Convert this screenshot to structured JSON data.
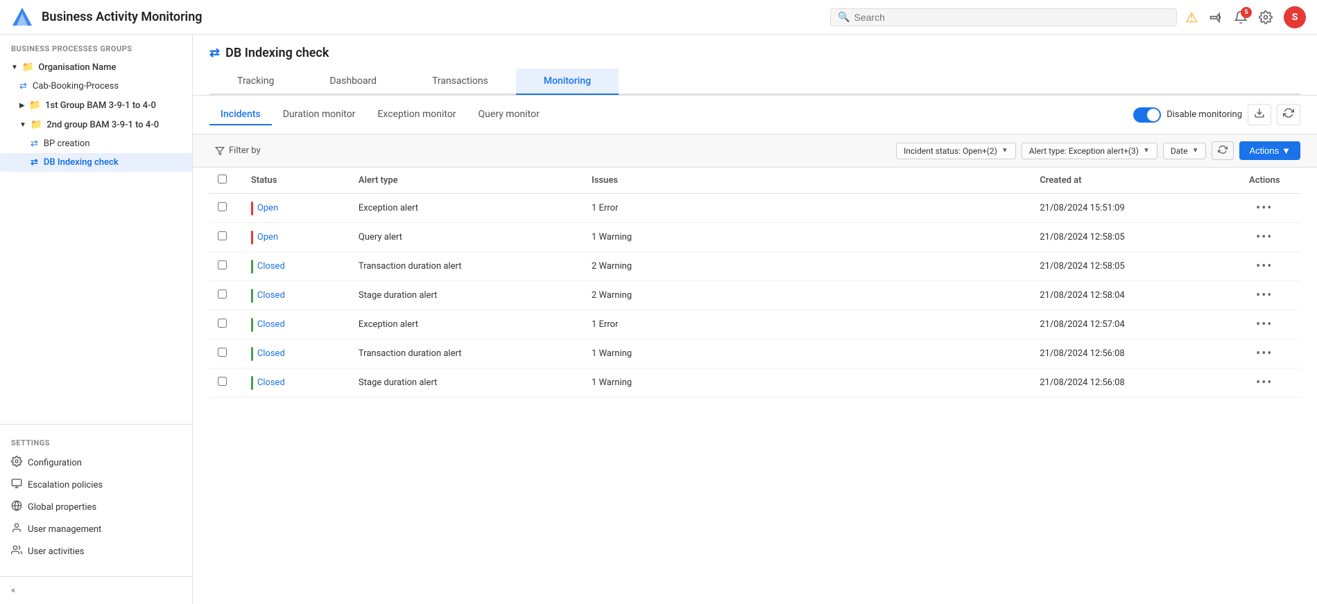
{
  "app": {
    "title": "Business Activity Monitoring",
    "logo_alt": "logo"
  },
  "search": {
    "placeholder": "Search"
  },
  "nav_icons": {
    "warning": "⚠",
    "bell": "🔔",
    "notification_count": "5",
    "megaphone": "📣",
    "gear": "⚙",
    "avatar_letter": "S"
  },
  "sidebar": {
    "groups_title": "BUSINESS PROCESSES GROUPS",
    "org_name": "Organisation Name",
    "groups": [
      {
        "name": "1st Group BAM 3-9-1 to 4-0",
        "expanded": false
      },
      {
        "name": "2nd group BAM 3-9-1 to 4-0",
        "expanded": true,
        "children": [
          {
            "name": "BP creation",
            "type": "bp"
          },
          {
            "name": "DB Indexing check",
            "type": "bp",
            "active": true
          }
        ]
      }
    ],
    "cab_booking": "Cab-Booking-Process",
    "settings_title": "SETTINGS",
    "settings_items": [
      {
        "icon": "⚙",
        "label": "Configuration"
      },
      {
        "icon": "📋",
        "label": "Escalation policies"
      },
      {
        "icon": "🌐",
        "label": "Global properties"
      },
      {
        "icon": "👤",
        "label": "User management"
      },
      {
        "icon": "👥",
        "label": "User activities"
      }
    ],
    "collapse_tooltip": "Collapse"
  },
  "page": {
    "title": "DB Indexing check",
    "title_icon": "⇄"
  },
  "tabs_top": [
    {
      "label": "Tracking",
      "active": false
    },
    {
      "label": "Dashboard",
      "active": false
    },
    {
      "label": "Transactions",
      "active": false
    },
    {
      "label": "Monitoring",
      "active": true
    }
  ],
  "sub_tabs": [
    {
      "label": "Incidents",
      "active": true
    },
    {
      "label": "Duration monitor",
      "active": false
    },
    {
      "label": "Exception monitor",
      "active": false
    },
    {
      "label": "Query monitor",
      "active": false
    }
  ],
  "monitoring": {
    "toggle_label": "Disable monitoring",
    "download_icon": "⬇",
    "refresh_icon": "↺"
  },
  "toolbar": {
    "filter_label": "Filter by",
    "filter_icon": "▼",
    "status_filter": "Incident status: Open+(2)",
    "alert_filter": "Alert type: Exception alert+(3)",
    "date_filter": "Date",
    "refresh_icon": "↺",
    "actions_label": "Actions",
    "actions_chevron": "▼"
  },
  "table": {
    "headers": [
      "",
      "Status",
      "Alert type",
      "Issues",
      "Created at",
      "Actions"
    ],
    "rows": [
      {
        "id": 1,
        "status": "Open",
        "status_color": "red",
        "alert_type": "Exception alert",
        "issues": "1 Error",
        "created_at": "21/08/2024 15:51:09"
      },
      {
        "id": 2,
        "status": "Open",
        "status_color": "red",
        "alert_type": "Query alert",
        "issues": "1 Warning",
        "created_at": "21/08/2024 12:58:05"
      },
      {
        "id": 3,
        "status": "Closed",
        "status_color": "green",
        "alert_type": "Transaction duration alert",
        "issues": "2 Warning",
        "created_at": "21/08/2024 12:58:05"
      },
      {
        "id": 4,
        "status": "Closed",
        "status_color": "green",
        "alert_type": "Stage duration alert",
        "issues": "2 Warning",
        "created_at": "21/08/2024 12:58:04"
      },
      {
        "id": 5,
        "status": "Closed",
        "status_color": "green",
        "alert_type": "Exception alert",
        "issues": "1 Error",
        "created_at": "21/08/2024 12:57:04"
      },
      {
        "id": 6,
        "status": "Closed",
        "status_color": "green",
        "alert_type": "Transaction duration alert",
        "issues": "1 Warning",
        "created_at": "21/08/2024 12:56:08"
      },
      {
        "id": 7,
        "status": "Closed",
        "status_color": "green",
        "alert_type": "Stage duration alert",
        "issues": "1 Warning",
        "created_at": "21/08/2024 12:56:08"
      }
    ]
  }
}
